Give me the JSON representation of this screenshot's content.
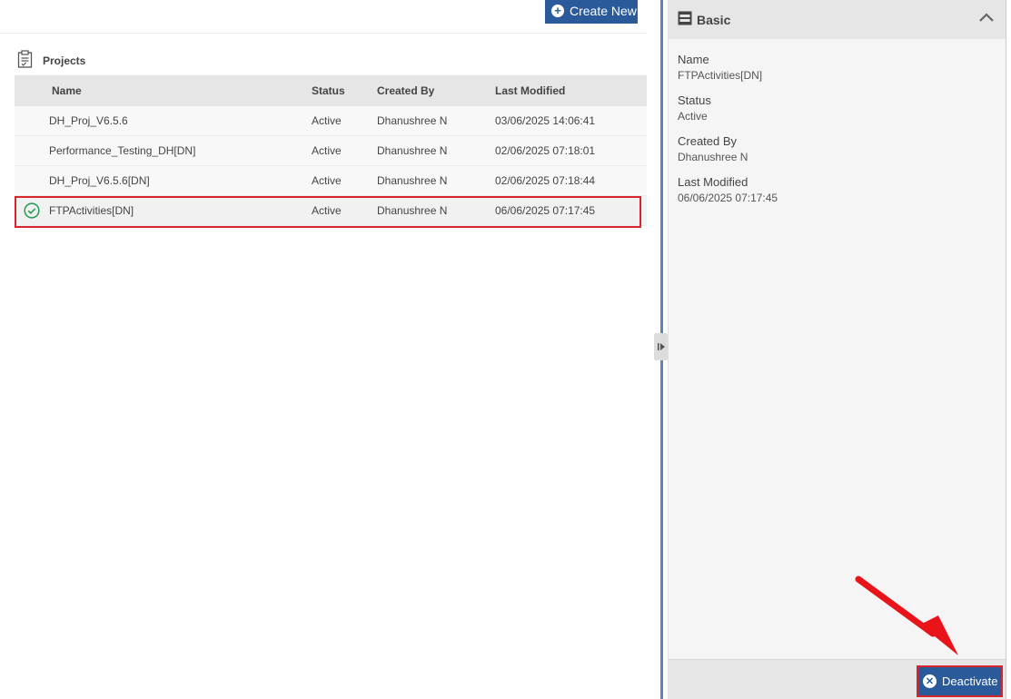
{
  "toolbar": {
    "create_new_label": "Create New"
  },
  "projects": {
    "title": "Projects",
    "columns": {
      "name": "Name",
      "status": "Status",
      "created_by": "Created By",
      "last_modified": "Last Modified"
    },
    "rows": [
      {
        "name": "DH_Proj_V6.5.6",
        "status": "Active",
        "created_by": "Dhanushree N",
        "last_modified": "03/06/2025 14:06:41"
      },
      {
        "name": "Performance_Testing_DH[DN]",
        "status": "Active",
        "created_by": "Dhanushree N",
        "last_modified": "02/06/2025 07:18:01"
      },
      {
        "name": "DH_Proj_V6.5.6[DN]",
        "status": "Active",
        "created_by": "Dhanushree N",
        "last_modified": "02/06/2025 07:18:44"
      },
      {
        "name": "FTPActivities[DN]",
        "status": "Active",
        "created_by": "Dhanushree N",
        "last_modified": "06/06/2025 07:17:45"
      }
    ]
  },
  "details": {
    "section_title": "Basic",
    "fields": [
      {
        "label": "Name",
        "value": "FTPActivities[DN]"
      },
      {
        "label": "Status",
        "value": "Active"
      },
      {
        "label": "Created By",
        "value": "Dhanushree N"
      },
      {
        "label": "Last Modified",
        "value": "06/06/2025 07:17:45"
      }
    ],
    "deactivate_label": "Deactivate"
  },
  "colors": {
    "primary": "#2a5a9a",
    "highlight": "#d9252c",
    "check": "#2e9e5b"
  }
}
